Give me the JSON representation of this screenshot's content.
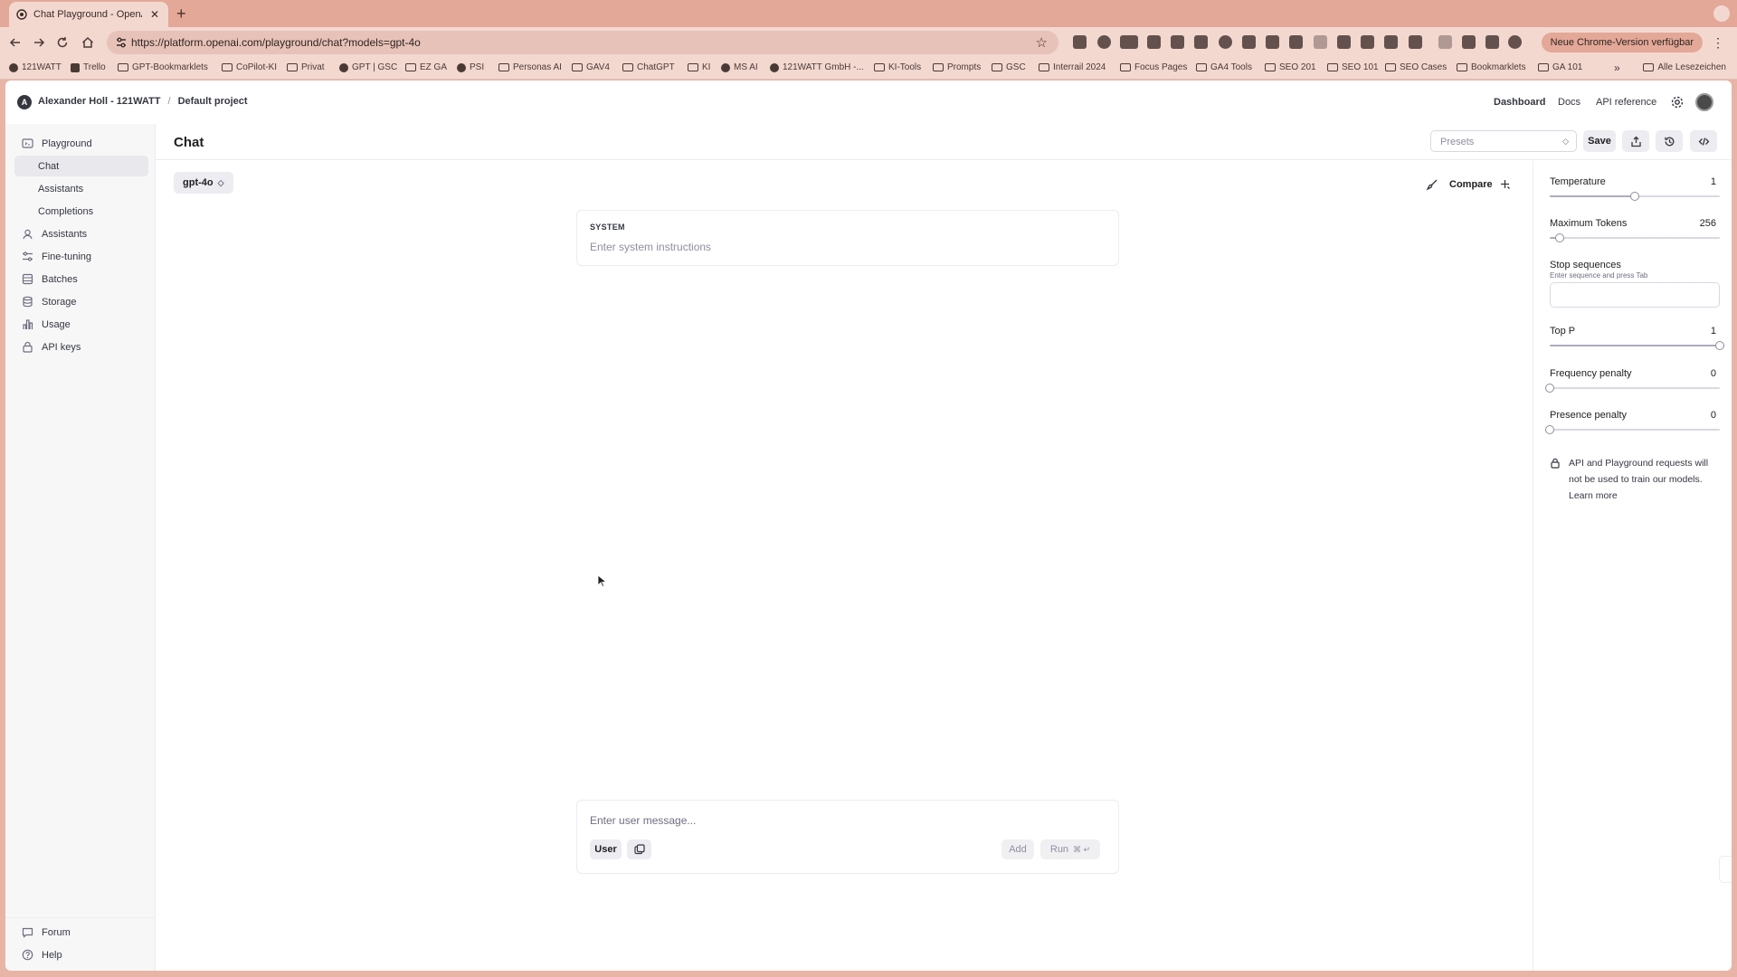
{
  "browser": {
    "tab_title": "Chat Playground - OpenAI API",
    "url": "https://platform.openai.com/playground/chat?models=gpt-4o",
    "update_label": "Neue Chrome-Version verfügbar",
    "bookmarks": [
      "121WATT",
      "Trello",
      "GPT-Bookmarklets",
      "CoPilot-KI",
      "Privat",
      "GPT | GSC",
      "EZ GA",
      "PSI",
      "Personas AI",
      "GAV4",
      "ChatGPT",
      "KI",
      "MS AI",
      "121WATT GmbH -...",
      "KI-Tools",
      "Prompts",
      "GSC",
      "Interrail 2024",
      "Focus Pages",
      "GA4 Tools",
      "SEO 201",
      "SEO 101",
      "SEO Cases",
      "Bookmarklets",
      "GA 101"
    ],
    "all_bookmarks_label": "Alle Lesezeichen"
  },
  "header": {
    "org_initial": "A",
    "org_name": "Alexander Holl - 121WATT",
    "separator": "/",
    "project": "Default project",
    "links": {
      "dashboard": "Dashboard",
      "docs": "Docs",
      "api_reference": "API reference"
    }
  },
  "sidebar": {
    "items": [
      {
        "label": "Playground",
        "icon": "playground-icon"
      },
      {
        "label": "Chat",
        "active": true
      },
      {
        "label": "Assistants"
      },
      {
        "label": "Completions"
      },
      {
        "label": "Assistants",
        "icon": "assistants-icon"
      },
      {
        "label": "Fine-tuning",
        "icon": "fine-tuning-icon"
      },
      {
        "label": "Batches",
        "icon": "batches-icon"
      },
      {
        "label": "Storage",
        "icon": "storage-icon"
      },
      {
        "label": "Usage",
        "icon": "usage-icon"
      },
      {
        "label": "API keys",
        "icon": "lock-icon"
      }
    ],
    "footer": [
      {
        "label": "Forum",
        "icon": "forum-icon"
      },
      {
        "label": "Help",
        "icon": "help-icon"
      }
    ]
  },
  "main": {
    "title": "Chat",
    "presets_placeholder": "Presets",
    "save_label": "Save",
    "model": "gpt-4o",
    "compare_label": "Compare",
    "system_label": "SYSTEM",
    "system_placeholder": "Enter system instructions",
    "user_placeholder": "Enter user message...",
    "role_label": "User",
    "add_label": "Add",
    "run_label": "Run",
    "run_shortcut": "⌘ ↵"
  },
  "params": {
    "temperature": {
      "label": "Temperature",
      "value": "1",
      "fraction": 0.5
    },
    "max_tokens": {
      "label": "Maximum Tokens",
      "value": "256",
      "fraction": 0.06
    },
    "stop": {
      "label": "Stop sequences",
      "hint": "Enter sequence and press Tab"
    },
    "top_p": {
      "label": "Top P",
      "value": "1",
      "fraction": 1.0
    },
    "frequency": {
      "label": "Frequency penalty",
      "value": "0",
      "fraction": 0.0
    },
    "presence": {
      "label": "Presence penalty",
      "value": "0",
      "fraction": 0.0
    }
  },
  "notice": {
    "text": "API and Playground requests will not be used to train our models.",
    "link": "Learn more"
  }
}
